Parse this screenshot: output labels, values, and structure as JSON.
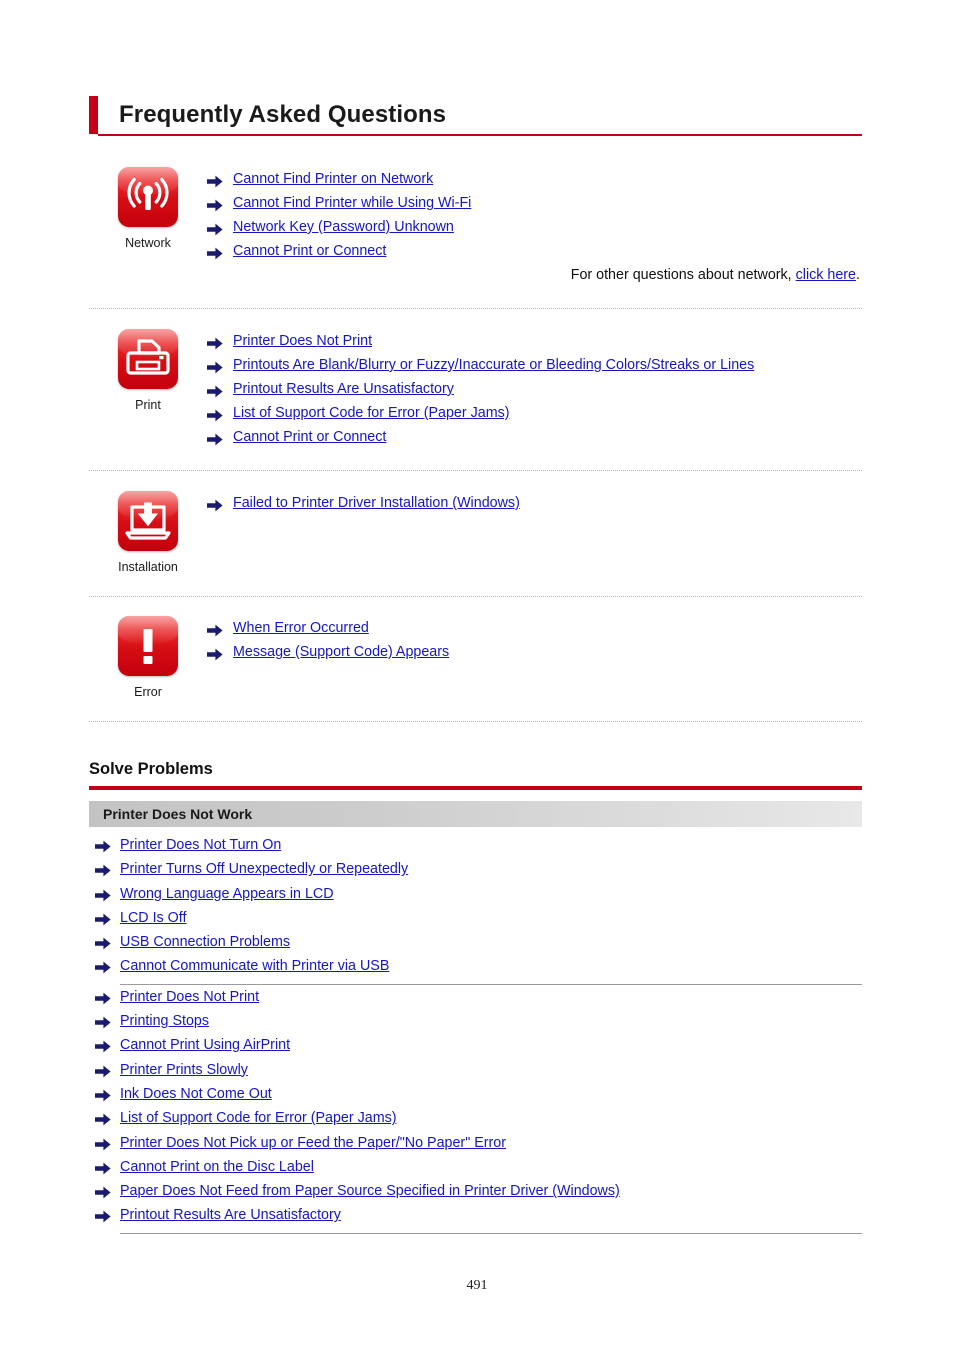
{
  "page": {
    "title": "Frequently Asked Questions",
    "page_number": "491",
    "accent_color": "#c20016",
    "link_color": "#1616c4",
    "arrow_color": "#1b1b6e"
  },
  "faq_sections": [
    {
      "icon": "wifi-icon",
      "caption": "Network",
      "links": [
        "Cannot Find Printer on Network",
        "Cannot Find Printer while Using Wi-Fi",
        "Network Key (Password) Unknown",
        "Cannot Print or Connect"
      ],
      "note_prefix": "For other questions about network, ",
      "note_link": "click here",
      "note_suffix": "."
    },
    {
      "icon": "printer-icon",
      "caption": "Print",
      "links": [
        "Printer Does Not Print",
        "Printouts Are Blank/Blurry or Fuzzy/Inaccurate or Bleeding Colors/Streaks or Lines",
        "Printout Results Are Unsatisfactory",
        "List of Support Code for Error (Paper Jams)",
        "Cannot Print or Connect"
      ]
    },
    {
      "icon": "laptop-download-icon",
      "caption": "Installation",
      "links": [
        "Failed to Printer Driver Installation (Windows)"
      ]
    },
    {
      "icon": "exclamation-icon",
      "caption": "Error",
      "links": [
        "When Error Occurred",
        "Message (Support Code) Appears"
      ]
    }
  ],
  "solve_problems": {
    "heading": "Solve Problems",
    "group_label": "Printer Does Not Work",
    "items": [
      "Printer Does Not Turn On",
      "Printer Turns Off Unexpectedly or Repeatedly",
      "Wrong Language Appears in LCD",
      "LCD Is Off",
      "USB Connection Problems",
      "Cannot Communicate with Printer via USB",
      "Printer Does Not Print",
      "Printing Stops",
      "Cannot Print Using AirPrint",
      "Printer Prints Slowly",
      "Ink Does Not Come Out",
      "List of Support Code for Error (Paper Jams)",
      "Printer Does Not Pick up or Feed the Paper/\"No Paper\" Error",
      "Cannot Print on the Disc Label",
      "Paper Does Not Feed from Paper Source Specified in Printer Driver (Windows)",
      "Printout Results Are Unsatisfactory"
    ],
    "separator_after_indices": [
      5,
      15
    ]
  }
}
